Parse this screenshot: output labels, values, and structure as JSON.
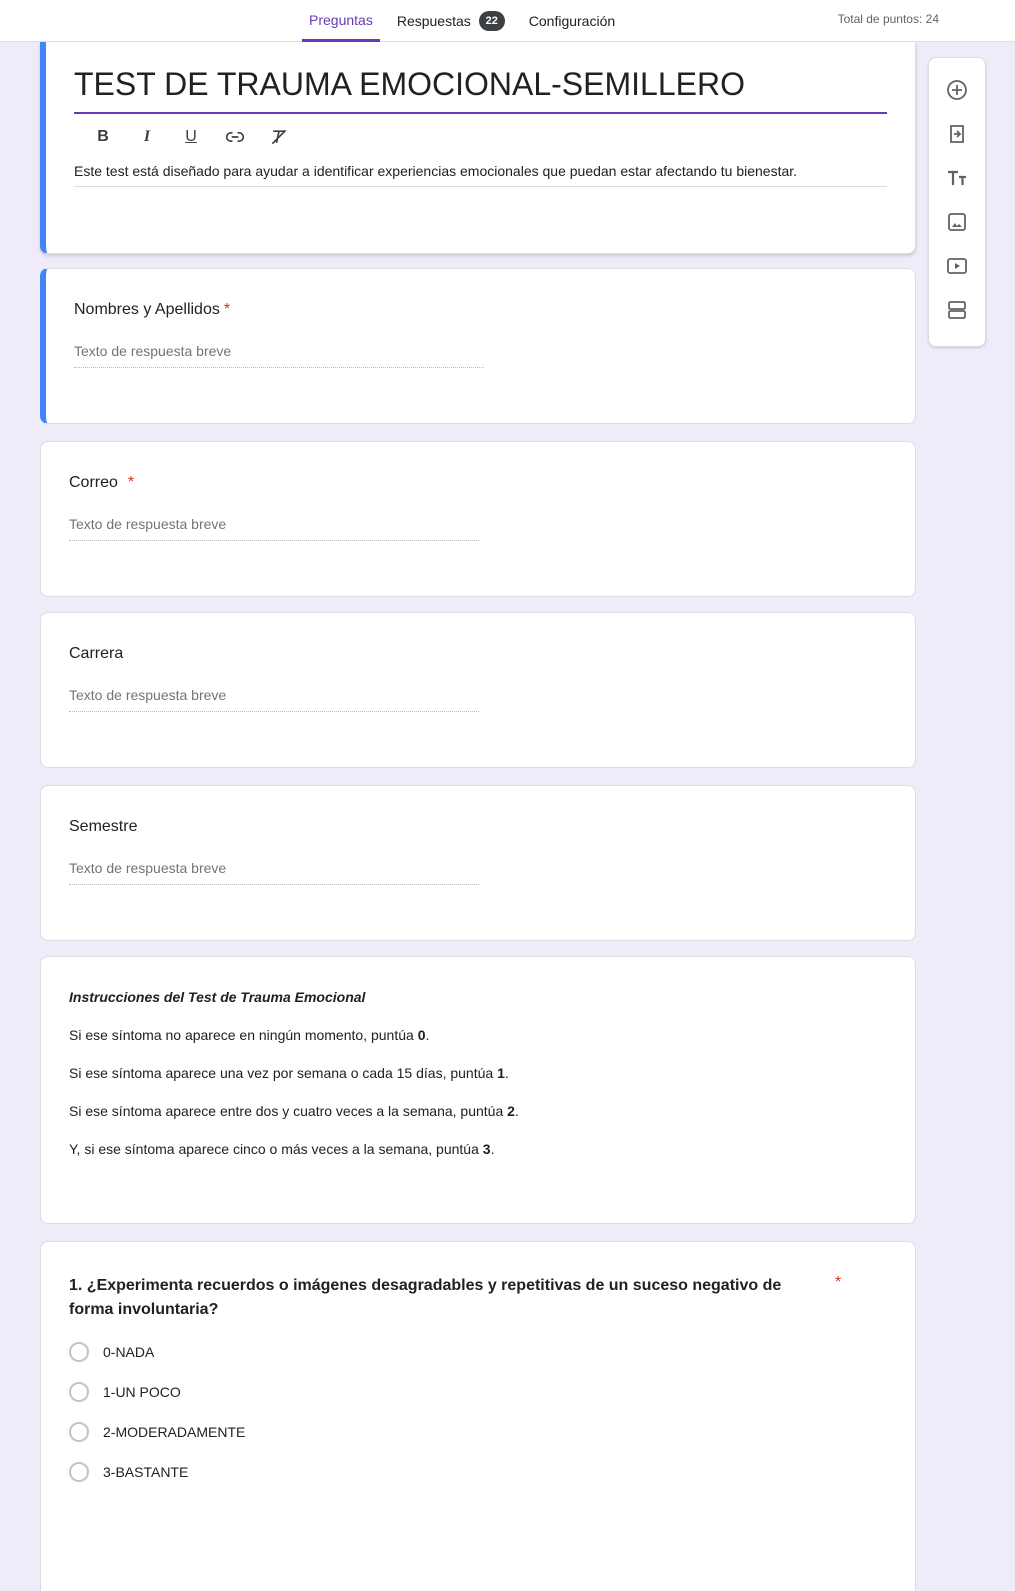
{
  "header": {
    "tabs": [
      {
        "label": "Preguntas",
        "active": true
      },
      {
        "label": "Respuestas",
        "badge": "22"
      },
      {
        "label": "Configuración"
      }
    ],
    "points": "Total de puntos: 24"
  },
  "form": {
    "title": "TEST DE TRAUMA EMOCIONAL-SEMILLERO",
    "description": "Este test está diseñado para ayudar a identificar experiencias emocionales que puedan estar afectando tu bienestar.",
    "format_buttons": [
      "B",
      "I",
      "U"
    ]
  },
  "questions": [
    {
      "title": "Nombres y Apellidos",
      "required": "*",
      "placeholder": "Texto de respuesta breve"
    },
    {
      "title": "Correo",
      "required": "*",
      "placeholder": "Texto de respuesta breve"
    },
    {
      "title": "Carrera",
      "placeholder": "Texto de respuesta breve"
    },
    {
      "title": "Semestre",
      "placeholder": "Texto de respuesta breve"
    }
  ],
  "instructions": {
    "title": "Instrucciones del Test de Trauma Emocional",
    "lines": [
      {
        "text": "Si ese síntoma no aparece en ningún momento, puntúa ",
        "score": "0"
      },
      {
        "text": "Si ese síntoma aparece una vez por semana o cada 15 días, puntúa ",
        "score": "1"
      },
      {
        "text": "Si ese síntoma aparece entre dos y cuatro veces a la semana, puntúa ",
        "score": "2"
      },
      {
        "text": "Y, si ese síntoma aparece cinco o más veces a la semana, puntúa ",
        "score": "3"
      }
    ]
  },
  "q1": {
    "title": "1. ¿Experimenta recuerdos o imágenes desagradables y repetitivas de un suceso negativo de forma involuntaria?",
    "required": "*",
    "options": [
      "0-NADA",
      "1-UN POCO",
      "2-MODERADAMENTE",
      "3-BASTANTE"
    ]
  },
  "toolbar": {
    "icons": [
      "add-question-icon",
      "import-questions-icon",
      "add-title-icon",
      "add-image-icon",
      "add-video-icon",
      "add-section-icon"
    ]
  },
  "colors": {
    "accent": "#673ab7",
    "active_card": "#4285f4",
    "required": "#d93025",
    "background": "#f0ebf8"
  }
}
